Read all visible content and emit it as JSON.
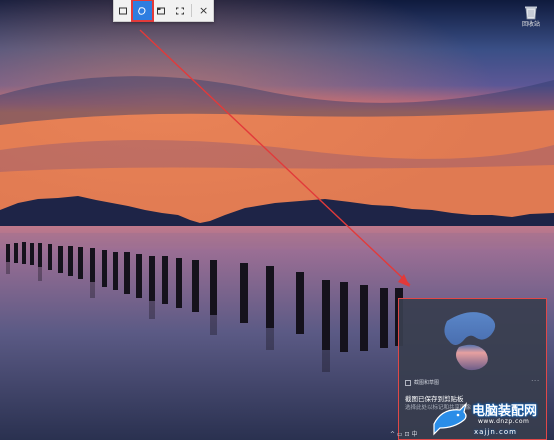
{
  "toolbar": {
    "items": [
      {
        "icon": "rectangle-snip-icon"
      },
      {
        "icon": "freeform-snip-icon",
        "selected": true
      },
      {
        "icon": "window-snip-icon"
      },
      {
        "icon": "fullscreen-snip-icon"
      }
    ],
    "close_glyph": "×"
  },
  "desktop": {
    "recycle_bin_label": "回收站"
  },
  "toast": {
    "app_name": "截图和草图",
    "more_glyph": "···",
    "title": "截图已保存到剪贴板",
    "body": "选择此处以标记和共享图像"
  },
  "taskbar": {
    "tray_text": "^ ▭ ⊡ 中"
  },
  "watermark": {
    "title": "电脑装配网",
    "url": "www.dnzp.com",
    "pinyin": "xajjn.com"
  },
  "colors": {
    "annotation_red": "#e23a3a",
    "accent_blue": "#2e7de0"
  }
}
